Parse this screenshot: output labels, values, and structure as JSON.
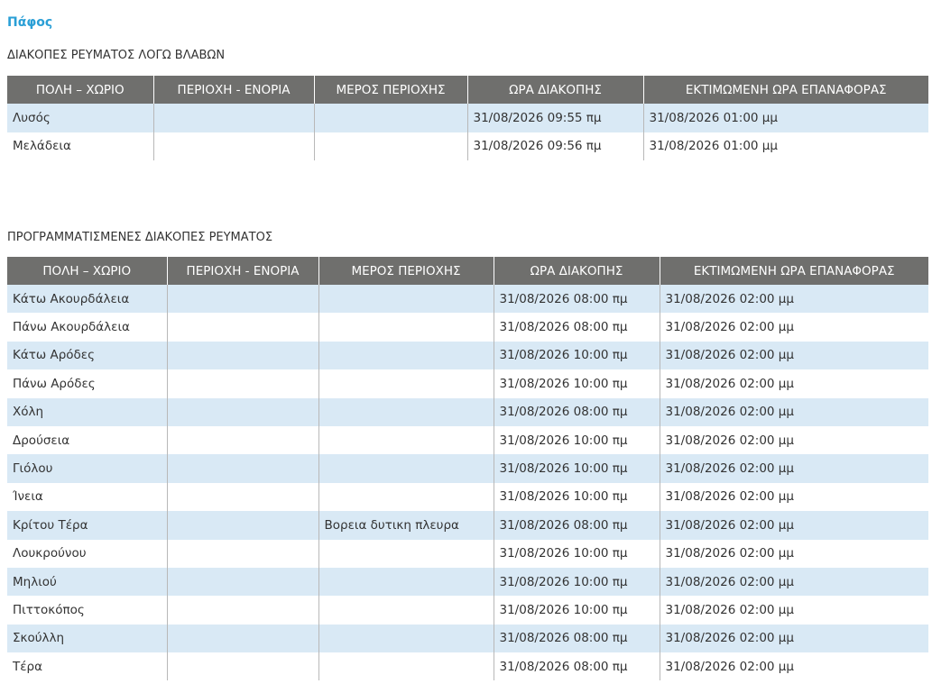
{
  "region_title": "Πάφος",
  "damage_section": {
    "heading": "ΔΙΑΚΟΠΕΣ ΡΕΥΜΑΤΟΣ ΛΟΓΩ ΒΛΑΒΩΝ",
    "columns": [
      "ΠΟΛΗ – ΧΩΡΙΟ",
      "ΠΕΡΙΟΧΗ - ΕΝΟΡΙΑ",
      "ΜΕΡΟΣ ΠΕΡΙΟΧΗΣ",
      "ΩΡΑ ΔΙΑΚΟΠΗΣ",
      "ΕΚΤΙΜΩΜΕΝΗ ΩΡΑ ΕΠΑΝΑΦΟΡΑΣ"
    ],
    "rows": [
      [
        "Λυσός",
        "",
        "",
        "31/08/2026 09:55 πμ",
        "31/08/2026 01:00 μμ"
      ],
      [
        "Μελάδεια",
        "",
        "",
        "31/08/2026 09:56 πμ",
        "31/08/2026 01:00 μμ"
      ]
    ]
  },
  "planned_section": {
    "heading": "ΠΡΟΓΡΑΜΜΑΤΙΣΜΕΝΕΣ ΔΙΑΚΟΠΕΣ ΡΕΥΜΑΤΟΣ",
    "columns": [
      "ΠΟΛΗ – ΧΩΡΙΟ",
      "ΠΕΡΙΟΧΗ - ΕΝΟΡΙΑ",
      "ΜΕΡΟΣ ΠΕΡΙΟΧΗΣ",
      "ΩΡΑ ΔΙΑΚΟΠΗΣ",
      "ΕΚΤΙΜΩΜΕΝΗ ΩΡΑ ΕΠΑΝΑΦΟΡΑΣ"
    ],
    "rows": [
      [
        "Κάτω Ακουρδάλεια",
        "",
        "",
        "31/08/2026 08:00 πμ",
        "31/08/2026 02:00 μμ"
      ],
      [
        "Πάνω Ακουρδάλεια",
        "",
        "",
        "31/08/2026 08:00 πμ",
        "31/08/2026 02:00 μμ"
      ],
      [
        "Κάτω Αρόδες",
        "",
        "",
        "31/08/2026 10:00 πμ",
        "31/08/2026 02:00 μμ"
      ],
      [
        "Πάνω Αρόδες",
        "",
        "",
        "31/08/2026 10:00 πμ",
        "31/08/2026 02:00 μμ"
      ],
      [
        "Χόλη",
        "",
        "",
        "31/08/2026 08:00 πμ",
        "31/08/2026 02:00 μμ"
      ],
      [
        "Δρούσεια",
        "",
        "",
        "31/08/2026 10:00 πμ",
        "31/08/2026 02:00 μμ"
      ],
      [
        "Γιόλου",
        "",
        "",
        "31/08/2026 10:00 πμ",
        "31/08/2026 02:00 μμ"
      ],
      [
        "Ίνεια",
        "",
        "",
        "31/08/2026 10:00 πμ",
        "31/08/2026 02:00 μμ"
      ],
      [
        "Κρίτου Τέρα",
        "",
        "Βορεια δυτικη πλευρα",
        "31/08/2026 08:00 πμ",
        "31/08/2026 02:00 μμ"
      ],
      [
        "Λουκρούνου",
        "",
        "",
        "31/08/2026 10:00 πμ",
        "31/08/2026 02:00 μμ"
      ],
      [
        "Μηλιού",
        "",
        "",
        "31/08/2026 10:00 πμ",
        "31/08/2026 02:00 μμ"
      ],
      [
        "Πιττοκόπος",
        "",
        "",
        "31/08/2026 10:00 πμ",
        "31/08/2026 02:00 μμ"
      ],
      [
        "Σκούλλη",
        "",
        "",
        "31/08/2026 08:00 πμ",
        "31/08/2026 02:00 μμ"
      ],
      [
        "Τέρα",
        "",
        "",
        "31/08/2026 08:00 πμ",
        "31/08/2026 02:00 μμ"
      ]
    ]
  }
}
